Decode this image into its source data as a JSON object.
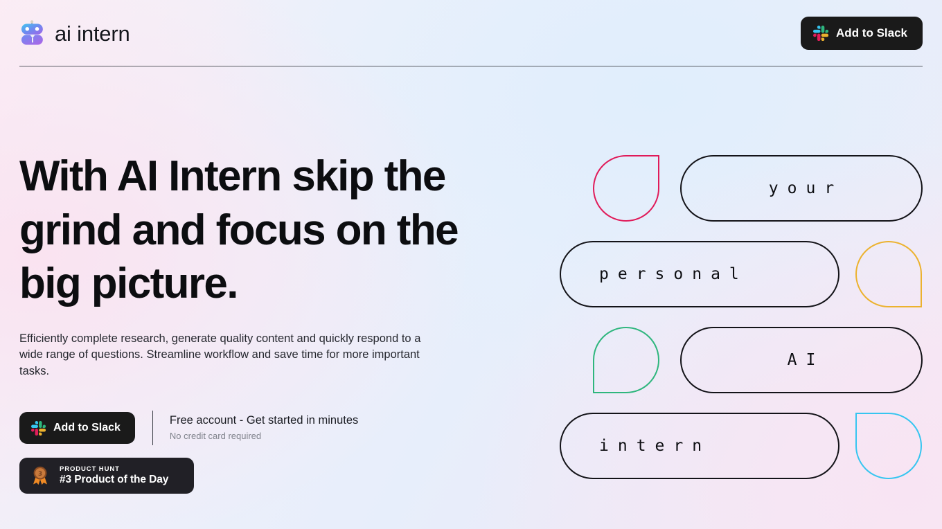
{
  "header": {
    "brand_name": "ai intern",
    "logo_icon": "robot-logo-icon",
    "cta_label": "Add to Slack",
    "cta_icon": "slack-icon"
  },
  "hero": {
    "headline": "With AI Intern skip the grind and focus on the big picture.",
    "subcopy": "Efficiently complete research, generate quality content and quickly respond to a wide range of questions. Streamline workflow and save time for more important tasks.",
    "cta_label": "Add to Slack",
    "cta_icon": "slack-icon",
    "cta_note_primary": "Free account - Get started in minutes",
    "cta_note_secondary": "No credit card required"
  },
  "product_hunt": {
    "kicker": "PRODUCT HUNT",
    "title": "#3 Product of the Day",
    "medal_icon": "bronze-medal-icon",
    "medal_rank": "3"
  },
  "art": {
    "rows": [
      {
        "drop_color": "#E01A59",
        "drop_corner": "tr",
        "drop_side": "left",
        "pill_text": "your",
        "align": "center"
      },
      {
        "drop_color": "#ECB22E",
        "drop_corner": "br",
        "drop_side": "right",
        "pill_text": "personal",
        "align": "lead"
      },
      {
        "drop_color": "#2EB67D",
        "drop_corner": "bl",
        "drop_side": "left",
        "pill_text": "AI",
        "align": "center"
      },
      {
        "drop_color": "#36C5F0",
        "drop_corner": "tl",
        "drop_side": "right",
        "pill_text": "intern",
        "align": "lead"
      }
    ],
    "pill_border_color": "#131318"
  },
  "colors": {
    "button_background": "#1a1a1a",
    "badge_background": "#212026",
    "text_primary": "#0c0d10",
    "text_muted": "#80838c",
    "slack_pink": "#E01E5A",
    "slack_blue": "#36C5F0",
    "slack_green": "#2EB67D",
    "slack_yellow": "#ECB22E"
  }
}
